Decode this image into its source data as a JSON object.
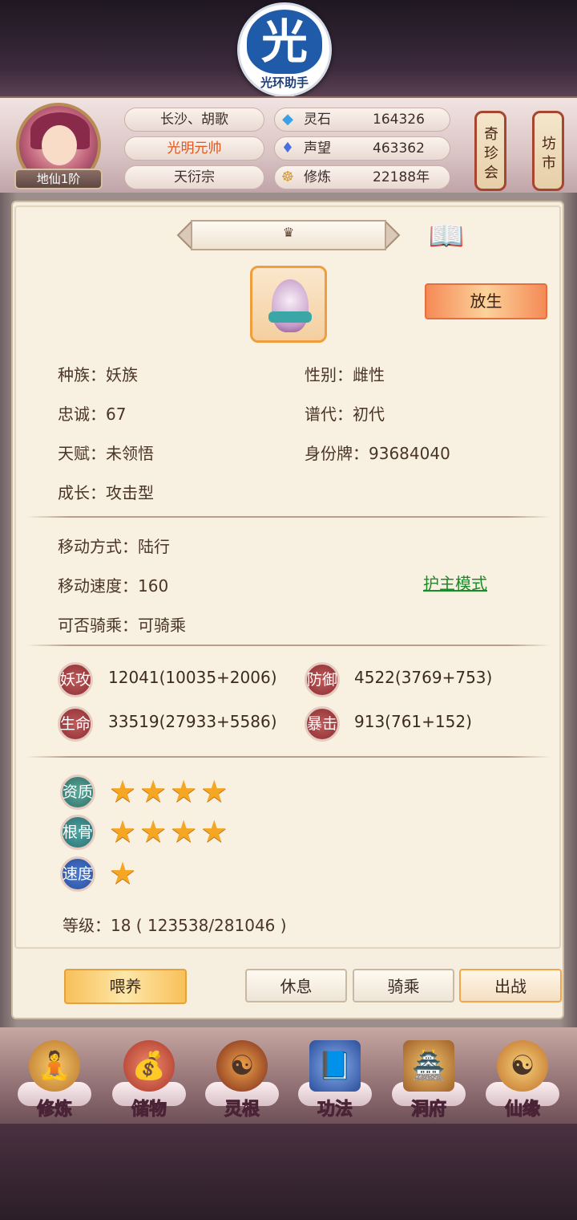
{
  "logo": {
    "glyph": "光",
    "caption": "光环助手"
  },
  "player": {
    "rank": "地仙1阶",
    "location": "长沙、胡歌",
    "title": "光明元帅",
    "sect": "天衍宗"
  },
  "resources": [
    {
      "icon": "spirit-stone-icon",
      "label": "灵石",
      "value": "164326"
    },
    {
      "icon": "reputation-icon",
      "label": "声望",
      "value": "463362"
    },
    {
      "icon": "cultivation-icon",
      "label": "修炼",
      "value": "22188年"
    }
  ],
  "lanterns": [
    "奇珍会",
    "坊市"
  ],
  "pet": {
    "crown": "♛",
    "release_label": "放生",
    "basic": {
      "race": "种族：妖族",
      "gender": "性别：雌性",
      "loyalty": "忠诚：67",
      "lineage": "谱代：初代",
      "talent": "天赋：未领悟",
      "id": "身份牌：93684040",
      "growth": "成长：攻击型"
    },
    "movement": {
      "mode": "移动方式：陆行",
      "speed": "移动速度：160",
      "rideable": "可否骑乘：可骑乘",
      "guard_link": "护主模式"
    },
    "stats": [
      {
        "badge": "妖攻",
        "value": "12041(10035+2006)"
      },
      {
        "badge": "防御",
        "value": "4522(3769+753)"
      },
      {
        "badge": "生命",
        "value": "33519(27933+5586)"
      },
      {
        "badge": "暴击",
        "value": "913(761+152)"
      }
    ],
    "qualities": [
      {
        "badge": "资质",
        "stars": 4
      },
      {
        "badge": "根骨",
        "stars": 4
      },
      {
        "badge": "速度",
        "stars": 1
      }
    ],
    "level": "等级：18 ( 123538/281046 )"
  },
  "actions": {
    "feed": "喂养",
    "rest": "休息",
    "ride": "骑乘",
    "fight": "出战"
  },
  "nav": [
    {
      "icon": "cultivate-icon",
      "label": "修炼"
    },
    {
      "icon": "storage-bag-icon",
      "label": "储物"
    },
    {
      "icon": "spirit-root-icon",
      "label": "灵根"
    },
    {
      "icon": "skill-book-icon",
      "label": "功法"
    },
    {
      "icon": "cave-mansion-icon",
      "label": "洞府"
    },
    {
      "icon": "fate-icon",
      "label": "仙缘"
    }
  ]
}
